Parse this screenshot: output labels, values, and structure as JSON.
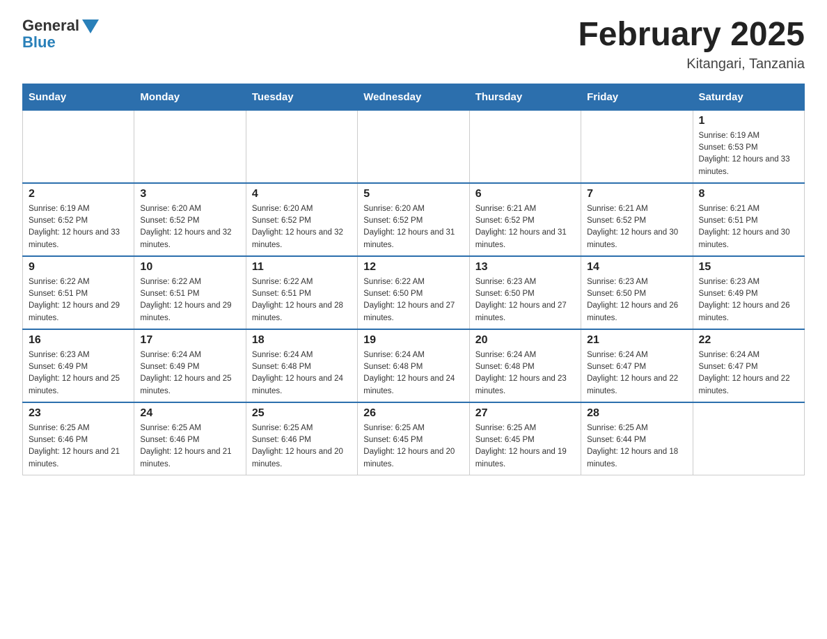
{
  "header": {
    "logo_general": "General",
    "logo_blue": "Blue",
    "title": "February 2025",
    "subtitle": "Kitangari, Tanzania"
  },
  "weekdays": [
    "Sunday",
    "Monday",
    "Tuesday",
    "Wednesday",
    "Thursday",
    "Friday",
    "Saturday"
  ],
  "weeks": [
    [
      {
        "day": "",
        "sunrise": "",
        "sunset": "",
        "daylight": ""
      },
      {
        "day": "",
        "sunrise": "",
        "sunset": "",
        "daylight": ""
      },
      {
        "day": "",
        "sunrise": "",
        "sunset": "",
        "daylight": ""
      },
      {
        "day": "",
        "sunrise": "",
        "sunset": "",
        "daylight": ""
      },
      {
        "day": "",
        "sunrise": "",
        "sunset": "",
        "daylight": ""
      },
      {
        "day": "",
        "sunrise": "",
        "sunset": "",
        "daylight": ""
      },
      {
        "day": "1",
        "sunrise": "Sunrise: 6:19 AM",
        "sunset": "Sunset: 6:53 PM",
        "daylight": "Daylight: 12 hours and 33 minutes."
      }
    ],
    [
      {
        "day": "2",
        "sunrise": "Sunrise: 6:19 AM",
        "sunset": "Sunset: 6:52 PM",
        "daylight": "Daylight: 12 hours and 33 minutes."
      },
      {
        "day": "3",
        "sunrise": "Sunrise: 6:20 AM",
        "sunset": "Sunset: 6:52 PM",
        "daylight": "Daylight: 12 hours and 32 minutes."
      },
      {
        "day": "4",
        "sunrise": "Sunrise: 6:20 AM",
        "sunset": "Sunset: 6:52 PM",
        "daylight": "Daylight: 12 hours and 32 minutes."
      },
      {
        "day": "5",
        "sunrise": "Sunrise: 6:20 AM",
        "sunset": "Sunset: 6:52 PM",
        "daylight": "Daylight: 12 hours and 31 minutes."
      },
      {
        "day": "6",
        "sunrise": "Sunrise: 6:21 AM",
        "sunset": "Sunset: 6:52 PM",
        "daylight": "Daylight: 12 hours and 31 minutes."
      },
      {
        "day": "7",
        "sunrise": "Sunrise: 6:21 AM",
        "sunset": "Sunset: 6:52 PM",
        "daylight": "Daylight: 12 hours and 30 minutes."
      },
      {
        "day": "8",
        "sunrise": "Sunrise: 6:21 AM",
        "sunset": "Sunset: 6:51 PM",
        "daylight": "Daylight: 12 hours and 30 minutes."
      }
    ],
    [
      {
        "day": "9",
        "sunrise": "Sunrise: 6:22 AM",
        "sunset": "Sunset: 6:51 PM",
        "daylight": "Daylight: 12 hours and 29 minutes."
      },
      {
        "day": "10",
        "sunrise": "Sunrise: 6:22 AM",
        "sunset": "Sunset: 6:51 PM",
        "daylight": "Daylight: 12 hours and 29 minutes."
      },
      {
        "day": "11",
        "sunrise": "Sunrise: 6:22 AM",
        "sunset": "Sunset: 6:51 PM",
        "daylight": "Daylight: 12 hours and 28 minutes."
      },
      {
        "day": "12",
        "sunrise": "Sunrise: 6:22 AM",
        "sunset": "Sunset: 6:50 PM",
        "daylight": "Daylight: 12 hours and 27 minutes."
      },
      {
        "day": "13",
        "sunrise": "Sunrise: 6:23 AM",
        "sunset": "Sunset: 6:50 PM",
        "daylight": "Daylight: 12 hours and 27 minutes."
      },
      {
        "day": "14",
        "sunrise": "Sunrise: 6:23 AM",
        "sunset": "Sunset: 6:50 PM",
        "daylight": "Daylight: 12 hours and 26 minutes."
      },
      {
        "day": "15",
        "sunrise": "Sunrise: 6:23 AM",
        "sunset": "Sunset: 6:49 PM",
        "daylight": "Daylight: 12 hours and 26 minutes."
      }
    ],
    [
      {
        "day": "16",
        "sunrise": "Sunrise: 6:23 AM",
        "sunset": "Sunset: 6:49 PM",
        "daylight": "Daylight: 12 hours and 25 minutes."
      },
      {
        "day": "17",
        "sunrise": "Sunrise: 6:24 AM",
        "sunset": "Sunset: 6:49 PM",
        "daylight": "Daylight: 12 hours and 25 minutes."
      },
      {
        "day": "18",
        "sunrise": "Sunrise: 6:24 AM",
        "sunset": "Sunset: 6:48 PM",
        "daylight": "Daylight: 12 hours and 24 minutes."
      },
      {
        "day": "19",
        "sunrise": "Sunrise: 6:24 AM",
        "sunset": "Sunset: 6:48 PM",
        "daylight": "Daylight: 12 hours and 24 minutes."
      },
      {
        "day": "20",
        "sunrise": "Sunrise: 6:24 AM",
        "sunset": "Sunset: 6:48 PM",
        "daylight": "Daylight: 12 hours and 23 minutes."
      },
      {
        "day": "21",
        "sunrise": "Sunrise: 6:24 AM",
        "sunset": "Sunset: 6:47 PM",
        "daylight": "Daylight: 12 hours and 22 minutes."
      },
      {
        "day": "22",
        "sunrise": "Sunrise: 6:24 AM",
        "sunset": "Sunset: 6:47 PM",
        "daylight": "Daylight: 12 hours and 22 minutes."
      }
    ],
    [
      {
        "day": "23",
        "sunrise": "Sunrise: 6:25 AM",
        "sunset": "Sunset: 6:46 PM",
        "daylight": "Daylight: 12 hours and 21 minutes."
      },
      {
        "day": "24",
        "sunrise": "Sunrise: 6:25 AM",
        "sunset": "Sunset: 6:46 PM",
        "daylight": "Daylight: 12 hours and 21 minutes."
      },
      {
        "day": "25",
        "sunrise": "Sunrise: 6:25 AM",
        "sunset": "Sunset: 6:46 PM",
        "daylight": "Daylight: 12 hours and 20 minutes."
      },
      {
        "day": "26",
        "sunrise": "Sunrise: 6:25 AM",
        "sunset": "Sunset: 6:45 PM",
        "daylight": "Daylight: 12 hours and 20 minutes."
      },
      {
        "day": "27",
        "sunrise": "Sunrise: 6:25 AM",
        "sunset": "Sunset: 6:45 PM",
        "daylight": "Daylight: 12 hours and 19 minutes."
      },
      {
        "day": "28",
        "sunrise": "Sunrise: 6:25 AM",
        "sunset": "Sunset: 6:44 PM",
        "daylight": "Daylight: 12 hours and 18 minutes."
      },
      {
        "day": "",
        "sunrise": "",
        "sunset": "",
        "daylight": ""
      }
    ]
  ]
}
